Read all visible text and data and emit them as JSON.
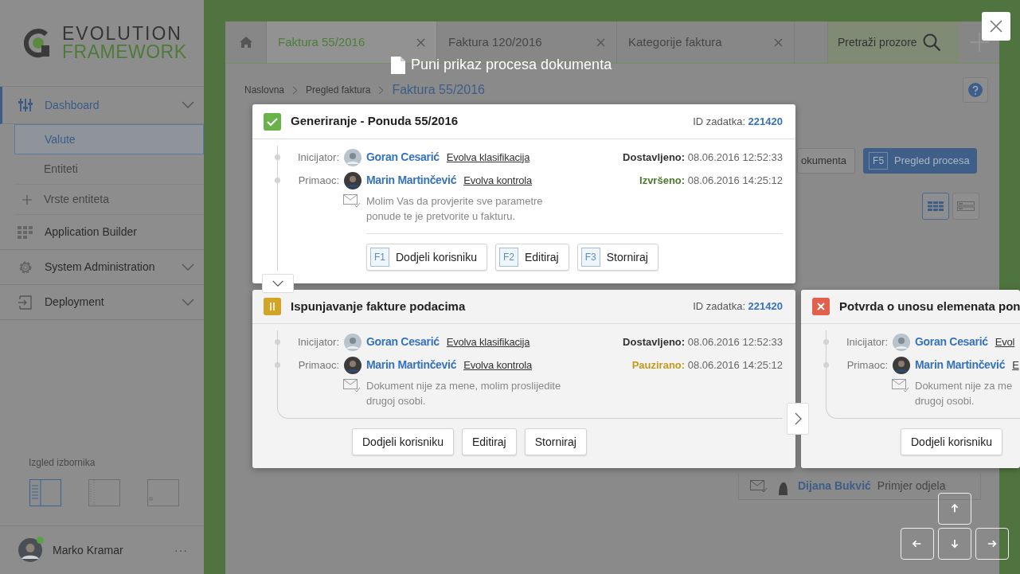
{
  "sidebar": {
    "logo": {
      "line1": "EVOLUTION",
      "line2": "FRAMEWORK"
    },
    "items": [
      {
        "label": "Dashboard",
        "kind": "sliders",
        "selected": true,
        "has_submenu": true,
        "children": [
          {
            "label": "Valute",
            "selected": true,
            "kind": "link"
          },
          {
            "label": "Entiteti",
            "selected": false,
            "kind": "link"
          },
          {
            "label": "Vrste entiteta",
            "selected": false,
            "kind": "add"
          }
        ]
      },
      {
        "label": "Application Builder",
        "kind": "grid",
        "selected": false,
        "has_submenu": false
      },
      {
        "label": "System Administration",
        "kind": "gear",
        "selected": false,
        "has_submenu": true
      },
      {
        "label": "Deployment",
        "kind": "enter",
        "selected": false,
        "has_submenu": true
      }
    ],
    "layout_label": "Izgled izbornika",
    "layouts": [
      {
        "kind": "full",
        "selected": true
      },
      {
        "kind": "compact",
        "selected": false
      },
      {
        "kind": "hidden",
        "selected": false
      }
    ],
    "user": {
      "name": "Marko Kramar",
      "online": true,
      "menu": "···"
    }
  },
  "window_tabs": [
    {
      "kind": "home",
      "selected": false
    },
    {
      "kind": "tab",
      "label": "Faktura 55/2016",
      "selected": true
    },
    {
      "kind": "tab",
      "label": "Faktura 120/2016",
      "selected": false
    },
    {
      "kind": "tab",
      "label": "Kategorije faktura",
      "selected": false
    }
  ],
  "window_search": "Pretraži prozore",
  "breadcrumb": [
    {
      "label": "Naslovna",
      "current": false
    },
    {
      "label": "Pregled faktura",
      "current": false
    },
    {
      "label": "Faktura 55/2016",
      "current": true
    }
  ],
  "toolbar": [
    {
      "kind": "plain",
      "label": "okumenta"
    },
    {
      "kind": "primary",
      "key": "F5",
      "label": "Pregled procesa"
    }
  ],
  "view_toggle": [
    {
      "kind": "table",
      "selected": true
    },
    {
      "kind": "list",
      "selected": false
    }
  ],
  "feed_row": {
    "name": "Dijana Bukvić",
    "department": "Primjer odjela"
  },
  "overlay": {
    "title": "Puni prikaz procesa dokumenta",
    "tasks": [
      {
        "kind": "done",
        "active": true,
        "title": "Generiranje - Ponuda 55/2016",
        "id_label": "ID zadatka:",
        "id": "221420",
        "initiator": {
          "label": "Inicijator:",
          "name": "Goran Cesarić",
          "org": "Evolva klasifikacija"
        },
        "recipient": {
          "label": "Primaoc:",
          "name": "Marin Martinčević",
          "org": "Evolva kontrola"
        },
        "delivered": {
          "label": "Dostavljeno:",
          "time": "08.06.2016 12:52:33"
        },
        "result": {
          "label": "Izvršeno:",
          "time": "08.06.2016 14:25:12"
        },
        "message": "Molim Vas da provjerite sve parametre ponude te je pretvorite u fakturu.",
        "actions": [
          {
            "key": "F1",
            "label": "Dodjeli korisniku"
          },
          {
            "key": "F2",
            "label": "Editiraj"
          },
          {
            "key": "F3",
            "label": "Storniraj"
          }
        ]
      },
      {
        "kind": "paused",
        "active": false,
        "title": "Ispunjavanje fakture podacima",
        "id_label": "ID zadatka:",
        "id": "221420",
        "initiator": {
          "label": "Inicijator:",
          "name": "Goran Cesarić",
          "org": "Evolva klasifikacija"
        },
        "recipient": {
          "label": "Primaoc:",
          "name": "Marin Martinčević",
          "org": "Evolva kontrola"
        },
        "delivered": {
          "label": "Dostavljeno:",
          "time": "08.06.2016 12:52:33"
        },
        "result": {
          "label": "Pauzirano:",
          "time": "08.06.2016 14:25:12"
        },
        "message": "Dokument nije za mene, molim proslijedite drugoj osobi.",
        "actions": [
          {
            "label": "Dodjeli korisniku"
          },
          {
            "label": "Editiraj"
          },
          {
            "label": "Storniraj"
          }
        ]
      },
      {
        "kind": "cancelled",
        "active": false,
        "title": "Potvrda o unosu elemenata pon",
        "initiator": {
          "label": "Inicijator:",
          "name": "Goran Cesarić",
          "org": "Evol"
        },
        "recipient": {
          "label": "Primaoc:",
          "name": "Marin Martinčević",
          "org": "E"
        },
        "message": "Dokument nije za me drugoj osobi.",
        "actions": [
          {
            "label": "Dodjeli korisniku"
          }
        ]
      }
    ]
  }
}
